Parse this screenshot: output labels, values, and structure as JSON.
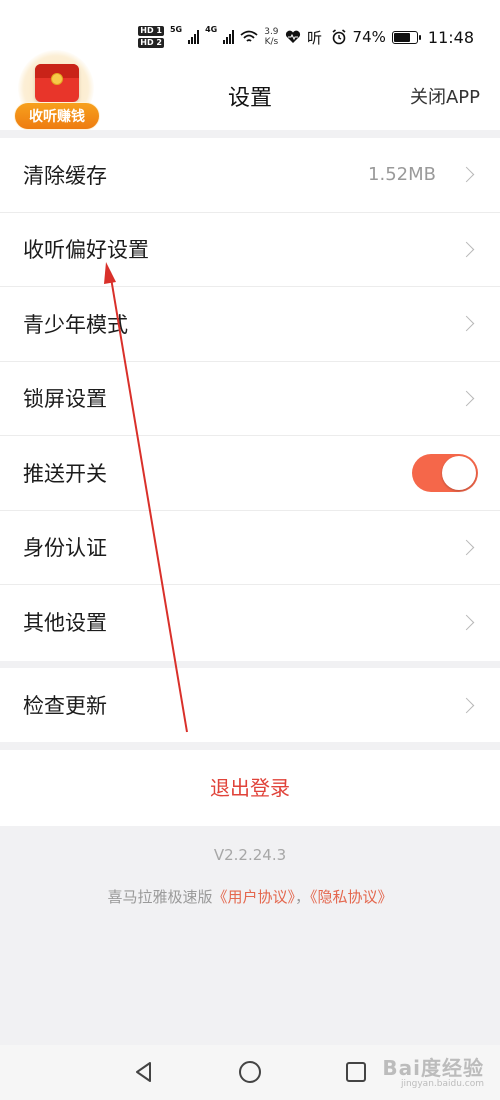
{
  "status_bar": {
    "hd_1": "HD 1",
    "hd_2": "HD 2",
    "signal_1_label": "5G",
    "signal_2_label": "4G",
    "net_speed_value": "3.9",
    "net_speed_unit": "K/s",
    "battery_percent": "74%",
    "battery_level": 0.74,
    "time": "11:48"
  },
  "header": {
    "title": "设置",
    "close_app": "关闭APP",
    "promo_label": "收听赚钱"
  },
  "settings": {
    "items": [
      {
        "label": "清除缓存",
        "value": "1.52MB"
      },
      {
        "label": "收听偏好设置"
      },
      {
        "label": "青少年模式"
      },
      {
        "label": "锁屏设置"
      },
      {
        "label": "推送开关",
        "toggle_on": true
      },
      {
        "label": "身份认证"
      },
      {
        "label": "其他设置"
      }
    ],
    "check_update": "检查更新"
  },
  "logout_label": "退出登录",
  "version": "V2.2.24.3",
  "footer": {
    "app_name": "喜马拉雅极速版",
    "user_agreement": "《用户协议》",
    "separator": "，",
    "privacy_policy": "《隐私协议》"
  },
  "watermark": {
    "main": "Bai度经验",
    "sub": "jingyan.baidu.com"
  },
  "colors": {
    "accent": "#f5674a",
    "logout": "#e0433a",
    "link": "#e4674e",
    "annotation": "#d9302a"
  },
  "icons": {
    "nav_back": "triangle-back-icon",
    "nav_home": "circle-home-icon",
    "nav_recent": "square-recent-icon"
  }
}
